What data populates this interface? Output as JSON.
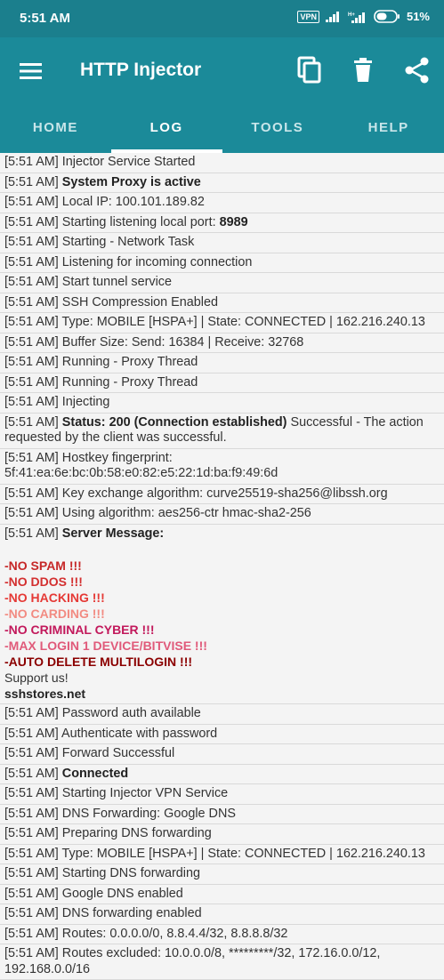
{
  "status_bar": {
    "time": "5:51 AM",
    "vpn": "VPN",
    "battery": "51%"
  },
  "app": {
    "title": "HTTP Injector"
  },
  "tabs": [
    {
      "label": "HOME"
    },
    {
      "label": "LOG"
    },
    {
      "label": "TOOLS"
    },
    {
      "label": "HELP"
    }
  ],
  "log": [
    {
      "prefix": "[5:51 AM] ",
      "text": "Injector Service Started"
    },
    {
      "prefix": "[5:51 AM] ",
      "bold": "System Proxy is active"
    },
    {
      "prefix": "[5:51 AM] ",
      "text": "Local IP: 100.101.189.82"
    },
    {
      "prefix": "[5:51 AM] ",
      "text": "Starting listening local port: ",
      "bold2": "8989"
    },
    {
      "prefix": "[5:51 AM] ",
      "text": "Starting - Network Task"
    },
    {
      "prefix": "[5:51 AM] ",
      "text": "Listening for incoming connection"
    },
    {
      "prefix": "[5:51 AM] ",
      "text": "Start tunnel service"
    },
    {
      "prefix": "[5:51 AM] ",
      "text": "SSH Compression Enabled"
    },
    {
      "prefix": "[5:51 AM] ",
      "text": "Type: MOBILE [HSPA+] | State: CONNECTED | 162.216.240.13"
    },
    {
      "prefix": "[5:51 AM] ",
      "text": "Buffer Size: Send: 16384 | Receive: 32768"
    },
    {
      "prefix": "[5:51 AM] ",
      "text": "Running - Proxy Thread"
    },
    {
      "prefix": "[5:51 AM] ",
      "text": "Running - Proxy Thread"
    },
    {
      "prefix": "[5:51 AM] ",
      "text": "Injecting"
    },
    {
      "prefix": "[5:51 AM] ",
      "bold": "Status: 200 (Connection established)",
      "text": " Successful - The action requested by the client was successful."
    },
    {
      "prefix": "[5:51 AM] ",
      "text": "Hostkey fingerprint: 5f:41:ea:6e:bc:0b:58:e0:82:e5:22:1d:ba:f9:49:6d"
    },
    {
      "prefix": "[5:51 AM] ",
      "text": "Key exchange algorithm: curve25519-sha256@libssh.org"
    },
    {
      "prefix": "[5:51 AM] ",
      "text": "Using algorithm: aes256-ctr hmac-sha2-256"
    },
    {
      "prefix": "[5:51 AM] ",
      "bold": "Server Message:",
      "server": true
    },
    {
      "prefix": "[5:51 AM] ",
      "text": "Password auth available"
    },
    {
      "prefix": "[5:51 AM] ",
      "text": "Authenticate with password"
    },
    {
      "prefix": "[5:51 AM] ",
      "text": "Forward Successful"
    },
    {
      "prefix": "[5:51 AM] ",
      "bold": "Connected"
    },
    {
      "prefix": "[5:51 AM] ",
      "text": "Starting Injector VPN Service"
    },
    {
      "prefix": "[5:51 AM] ",
      "text": "DNS Forwarding: Google DNS"
    },
    {
      "prefix": "[5:51 AM] ",
      "text": "Preparing DNS forwarding"
    },
    {
      "prefix": "[5:51 AM] ",
      "text": "Type: MOBILE [HSPA+] | State: CONNECTED | 162.216.240.13"
    },
    {
      "prefix": "[5:51 AM] ",
      "text": "Starting DNS forwarding"
    },
    {
      "prefix": "[5:51 AM] ",
      "text": "Google DNS enabled"
    },
    {
      "prefix": "[5:51 AM] ",
      "text": "DNS forwarding enabled"
    },
    {
      "prefix": "[5:51 AM] ",
      "text": "Routes: 0.0.0.0/0, 8.8.4.4/32, 8.8.8.8/32"
    },
    {
      "prefix": "[5:51 AM] ",
      "text": "Routes excluded: 10.0.0.0/8, *********/32, 172.16.0.0/12, 192.168.0.0/16"
    }
  ],
  "server_message": {
    "lines": [
      {
        "text": "-NO SPAM !!!",
        "color": "#c62828"
      },
      {
        "text": "-NO DDOS !!!",
        "color": "#d32f2f"
      },
      {
        "text": "-NO HACKING !!!",
        "color": "#e53935"
      },
      {
        "text": "-NO CARDING !!!",
        "color": "#f28b82"
      },
      {
        "text": "-NO CRIMINAL CYBER !!!",
        "color": "#c2185b"
      },
      {
        "text": "-MAX LOGIN 1 DEVICE/BITVISE !!!",
        "color": "#e05a7a"
      },
      {
        "text": "-AUTO DELETE MULTILOGIN !!!",
        "color": "#8b0000"
      }
    ],
    "support": "Support us!",
    "site": "sshstores.net"
  }
}
